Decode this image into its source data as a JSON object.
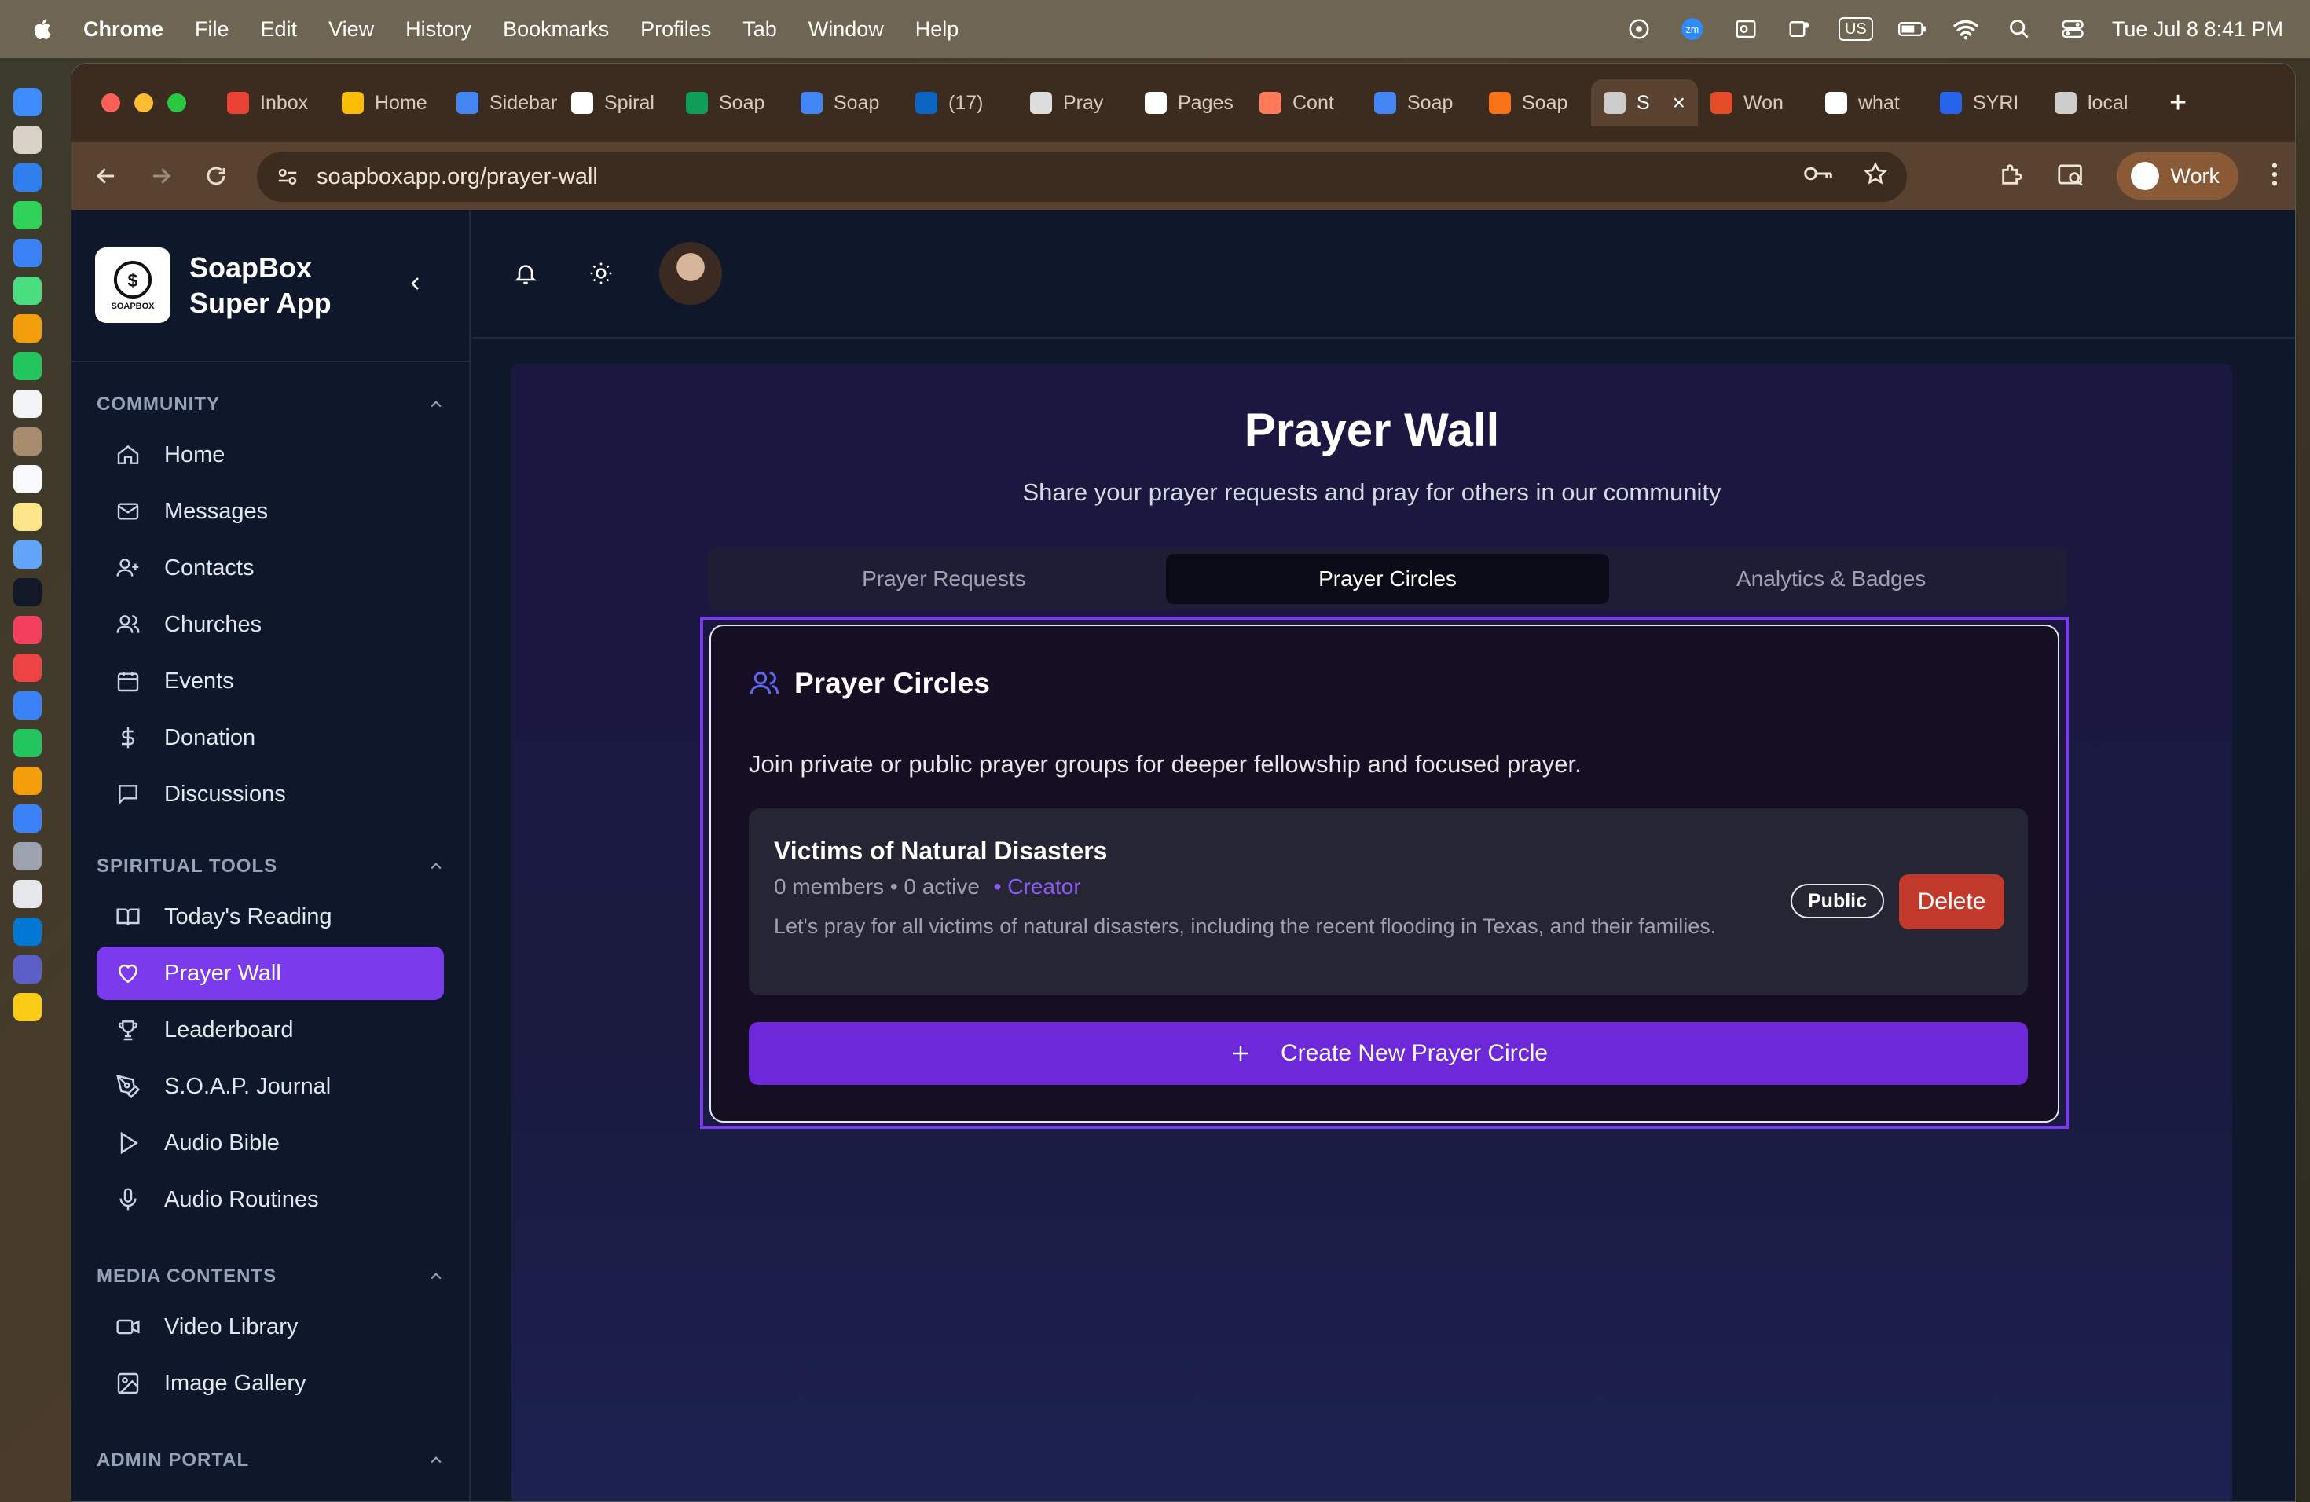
{
  "menubar": {
    "app_name": "Chrome",
    "items": [
      "File",
      "Edit",
      "View",
      "History",
      "Bookmarks",
      "Profiles",
      "Tab",
      "Window",
      "Help"
    ],
    "keyboard": "US",
    "clock": "Tue Jul 8  8:41 PM"
  },
  "browser": {
    "tabs": [
      {
        "label": "Inbox",
        "color": "#ea4335"
      },
      {
        "label": "Home",
        "color": "#fbbc04"
      },
      {
        "label": "Sidebar",
        "color": "#4285f4"
      },
      {
        "label": "Spiral",
        "color": "#ffffff"
      },
      {
        "label": "Soap",
        "color": "#0f9d58"
      },
      {
        "label": "Soap",
        "color": "#4285f4"
      },
      {
        "label": "(17)",
        "color": "#0a66c2"
      },
      {
        "label": "Pray",
        "color": "#dddddd"
      },
      {
        "label": "Pages",
        "color": "#ffffff"
      },
      {
        "label": "Cont",
        "color": "#ff7a59"
      },
      {
        "label": "Soap",
        "color": "#4285f4"
      },
      {
        "label": "Soap",
        "color": "#f97316"
      },
      {
        "label": "S",
        "color": "#cccccc"
      },
      {
        "label": "Won",
        "color": "#e34c26"
      },
      {
        "label": "what",
        "color": "#ffffff"
      },
      {
        "label": "SYRI",
        "color": "#2563eb"
      },
      {
        "label": "local",
        "color": "#cccccc"
      }
    ],
    "url": "soapboxapp.org/prayer-wall",
    "profile_label": "Work"
  },
  "sidebar": {
    "brand_line1": "SoapBox",
    "brand_line2": "Super App",
    "logo_text": "SOAPBOX",
    "sections": [
      {
        "title": "COMMUNITY",
        "items": [
          "Home",
          "Messages",
          "Contacts",
          "Churches",
          "Events",
          "Donation",
          "Discussions"
        ]
      },
      {
        "title": "SPIRITUAL TOOLS",
        "items": [
          "Today's Reading",
          "Prayer Wall",
          "Leaderboard",
          "S.O.A.P. Journal",
          "Audio Bible",
          "Audio Routines"
        ]
      },
      {
        "title": "MEDIA CONTENTS",
        "items": [
          "Video Library",
          "Image Gallery"
        ]
      },
      {
        "title": "ADMIN PORTAL",
        "items": []
      }
    ]
  },
  "main": {
    "title": "Prayer Wall",
    "subtitle": "Share your prayer requests and pray for others in our community",
    "tabs": [
      "Prayer Requests",
      "Prayer Circles",
      "Analytics & Badges"
    ],
    "card": {
      "heading": "Prayer Circles",
      "description": "Join private or public prayer groups for deeper fellowship and focused prayer.",
      "circle": {
        "name": "Victims of Natural Disasters",
        "members": "0 members",
        "active": "0 active",
        "role": "• Creator",
        "details": "Let's pray for all victims of natural disasters, including the recent flooding in Texas, and their families.",
        "visibility": "Public",
        "delete_label": "Delete"
      },
      "create_label": "Create New Prayer Circle"
    }
  }
}
